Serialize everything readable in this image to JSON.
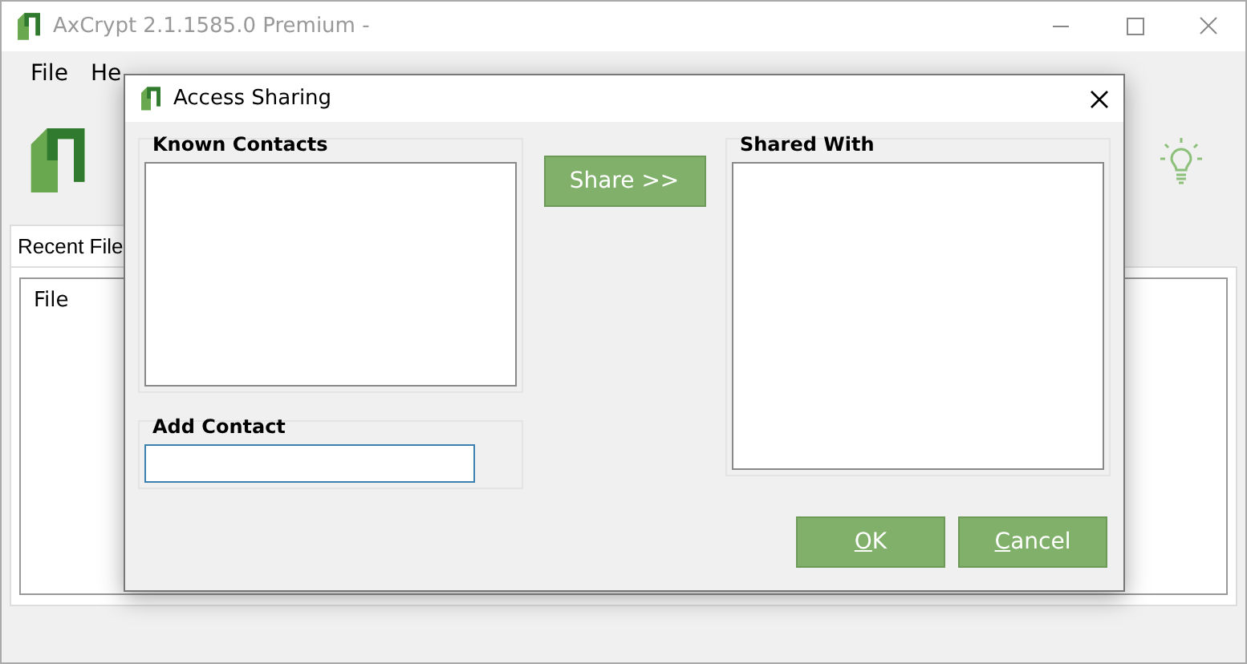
{
  "window": {
    "title": "AxCrypt 2.1.1585.0 Premium -"
  },
  "menu": [
    {
      "label": "File"
    },
    {
      "label": "He"
    }
  ],
  "tabs": [
    {
      "label": "Recent File",
      "selected": true
    }
  ],
  "file_list": {
    "columns": [
      "File"
    ]
  },
  "dialog": {
    "title": "Access Sharing",
    "known_contacts": {
      "title": "Known Contacts"
    },
    "share_button": "Share >>",
    "shared_with": {
      "title": "Shared With"
    },
    "add_contact": {
      "title": "Add Contact"
    },
    "buttons": [
      {
        "access_key": "O",
        "rest": "K"
      },
      {
        "access_key": "C",
        "rest": "ancel"
      }
    ]
  }
}
